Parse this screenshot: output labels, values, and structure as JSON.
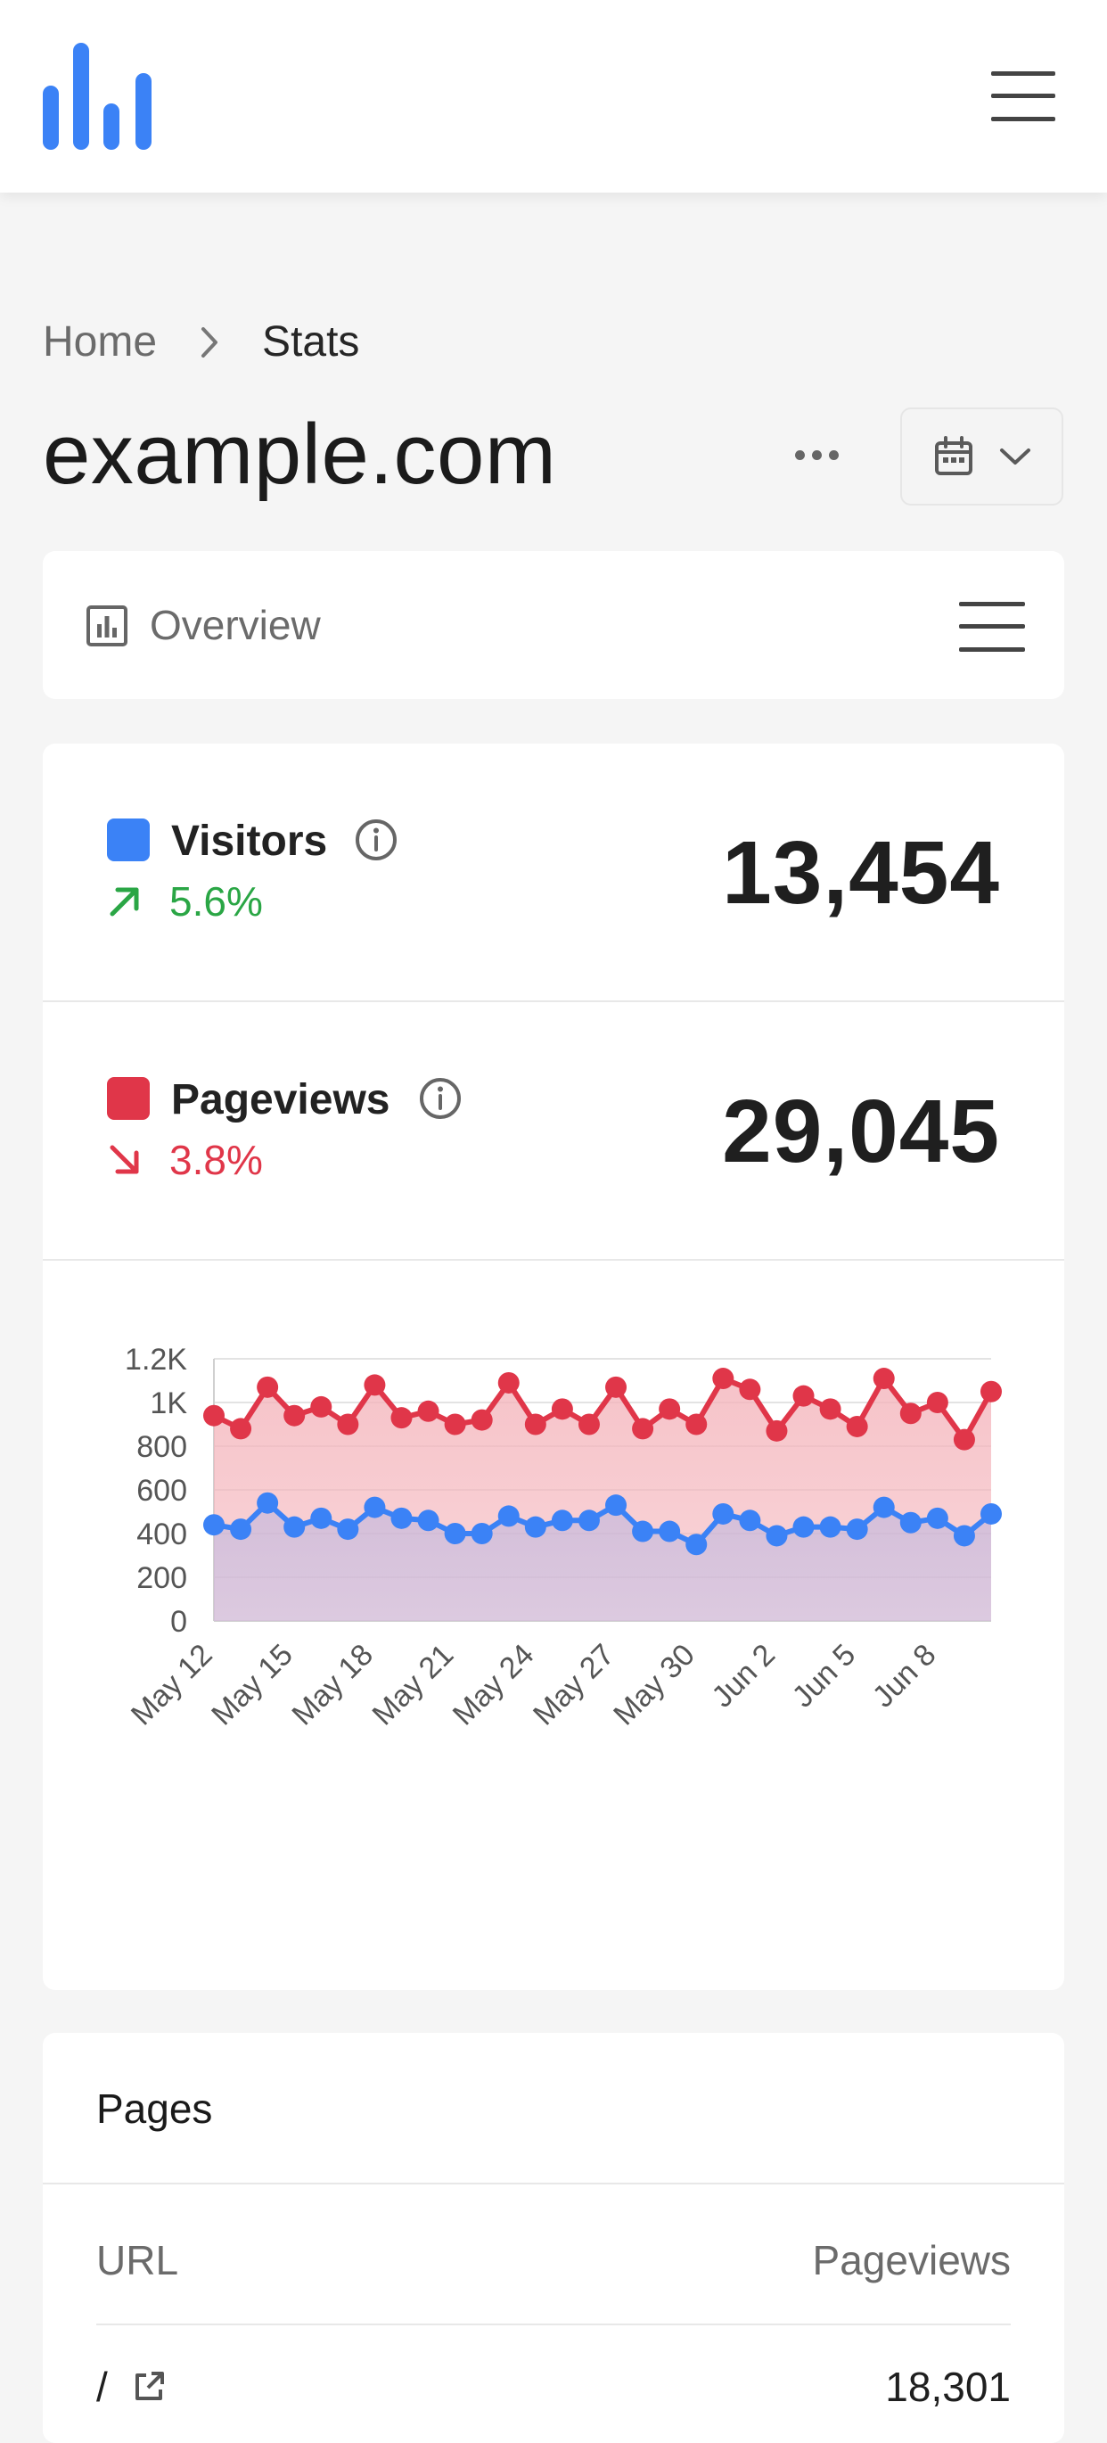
{
  "app": {
    "logo_icon": "bar-chart-logo-icon",
    "menu_icon": "hamburger-menu-icon"
  },
  "breadcrumb": {
    "home": "Home",
    "current": "Stats"
  },
  "site": {
    "title": "example.com"
  },
  "overview": {
    "label": "Overview",
    "icon": "bar-chart-square-icon"
  },
  "metrics": {
    "visitors": {
      "label": "Visitors",
      "change": "5.6%",
      "direction": "up",
      "value": "13,454",
      "color": "#3b82f6",
      "trend_color": "#2aa645"
    },
    "pageviews": {
      "label": "Pageviews",
      "change": "3.8%",
      "direction": "down",
      "value": "29,045",
      "color": "#e03649",
      "trend_color": "#e03649"
    }
  },
  "chart_data": {
    "type": "area",
    "x": [
      "May 12",
      "May 13",
      "May 14",
      "May 15",
      "May 16",
      "May 17",
      "May 18",
      "May 19",
      "May 20",
      "May 21",
      "May 22",
      "May 23",
      "May 24",
      "May 25",
      "May 26",
      "May 27",
      "May 28",
      "May 29",
      "May 30",
      "May 31",
      "Jun 1",
      "Jun 2",
      "Jun 3",
      "Jun 4",
      "Jun 5",
      "Jun 6",
      "Jun 7",
      "Jun 8",
      "Jun 9",
      "Jun 10"
    ],
    "x_tick_labels": [
      "May 12",
      "May 15",
      "May 18",
      "May 21",
      "May 24",
      "May 27",
      "May 30",
      "Jun 2",
      "Jun 5",
      "Jun 8"
    ],
    "y_tick_labels": [
      "0",
      "200",
      "400",
      "600",
      "800",
      "1K",
      "1.2K"
    ],
    "ylim": [
      0,
      1200
    ],
    "grid": true,
    "series": [
      {
        "name": "Pageviews",
        "color": "#e03649",
        "values": [
          940,
          880,
          1070,
          940,
          980,
          900,
          1080,
          930,
          960,
          900,
          920,
          1090,
          900,
          970,
          900,
          1070,
          880,
          970,
          900,
          1110,
          1060,
          870,
          1030,
          970,
          890,
          1110,
          950,
          1000,
          830,
          1050
        ]
      },
      {
        "name": "Visitors",
        "color": "#3b82f6",
        "values": [
          440,
          420,
          540,
          430,
          470,
          420,
          520,
          470,
          460,
          400,
          400,
          480,
          430,
          460,
          460,
          530,
          410,
          410,
          350,
          490,
          460,
          390,
          430,
          430,
          420,
          520,
          450,
          470,
          390,
          490
        ]
      }
    ]
  },
  "pages": {
    "title": "Pages",
    "columns": {
      "url": "URL",
      "pageviews": "Pageviews"
    },
    "rows": [
      {
        "url": "/",
        "pageviews": "18,301"
      }
    ]
  }
}
